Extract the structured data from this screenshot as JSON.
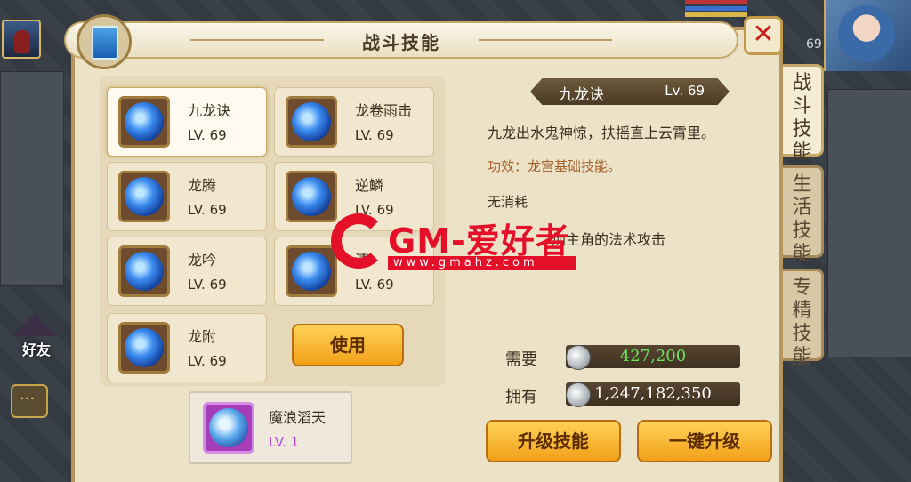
{
  "window": {
    "title": "战斗技能",
    "close_symbol": "✕"
  },
  "hud": {
    "level": "69"
  },
  "side": {
    "friends_label": "好友"
  },
  "skills": [
    {
      "name": "九龙诀",
      "level": "LV. 69"
    },
    {
      "name": "龙卷雨击",
      "level": "LV. 69"
    },
    {
      "name": "龙腾",
      "level": "LV. 69"
    },
    {
      "name": "逆鳞",
      "level": "LV. 69"
    },
    {
      "name": "龙吟",
      "level": "LV. 69"
    },
    {
      "name": "清",
      "level": "LV. 69"
    },
    {
      "name": "龙附",
      "level": "LV. 69"
    }
  ],
  "use_button": "使用",
  "special_skill": {
    "name": "魔浪滔天",
    "level": "LV. 1"
  },
  "detail": {
    "name": "九龙诀",
    "level": "Lv. 69",
    "description": "九龙出水鬼神惊，扶摇直上云霄里。",
    "effect": "功效：龙宫基础技能。",
    "cost": "无消耗",
    "passive": "加主角的法术攻击"
  },
  "resources": {
    "need_label": "需要",
    "need_value": "427,200",
    "have_label": "拥有",
    "have_value": "1,247,182,350"
  },
  "buttons": {
    "upgrade": "升级技能",
    "one_click": "一键升级"
  },
  "tabs": [
    {
      "label": "战斗技能",
      "active": true
    },
    {
      "label": "生活技能",
      "active": false
    },
    {
      "label": "专精技能",
      "active": false
    }
  ],
  "watermark": {
    "brand": "GM-爱好者",
    "url": "www.gmahz.com"
  },
  "colors": {
    "panel_bg": "#ebe2c7",
    "accent_button": "#f1a019",
    "need_value": "#6be25a",
    "special_level": "#b44bd1"
  }
}
